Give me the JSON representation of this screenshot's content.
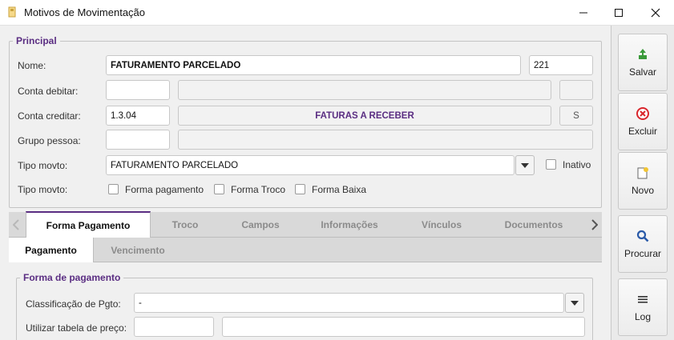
{
  "window": {
    "title": "Motivos de Movimentação",
    "minimize_icon": "minimize-icon",
    "maximize_icon": "maximize-icon",
    "close_icon": "close-icon"
  },
  "principal": {
    "legend": "Principal",
    "nome": {
      "label": "Nome:",
      "value": "FATURAMENTO PARCELADO",
      "code": "221"
    },
    "conta_debitar": {
      "label": "Conta debitar:",
      "code": "",
      "description": "",
      "flag": ""
    },
    "conta_creditar": {
      "label": "Conta creditar:",
      "code": "1.3.04",
      "description": "FATURAS A RECEBER",
      "flag": "S"
    },
    "grupo_pessoa": {
      "label": "Grupo pessoa:",
      "code": "",
      "description": ""
    },
    "tipo_movto": {
      "label": "Tipo movto:",
      "value": "FATURAMENTO PARCELADO",
      "inativo_label": "Inativo",
      "inativo_checked": false
    },
    "tipo_movto2": {
      "label": "Tipo movto:",
      "options": [
        {
          "label": "Forma pagamento",
          "checked": false
        },
        {
          "label": "Forma Troco",
          "checked": false
        },
        {
          "label": "Forma Baixa",
          "checked": false
        }
      ]
    }
  },
  "tabs": [
    "Forma Pagamento",
    "Troco",
    "Campos",
    "Informações",
    "Vínculos",
    "Documentos"
  ],
  "active_tab": "Forma Pagamento",
  "subtabs": [
    "Pagamento",
    "Vencimento"
  ],
  "active_subtab": "Pagamento",
  "forma_pagamento": {
    "legend": "Forma de pagamento",
    "classificacao": {
      "label": "Classificação de Pgto:",
      "value": "-"
    },
    "tabela_preco": {
      "label": "Utilizar tabela de preço:",
      "code": "",
      "description": ""
    }
  },
  "sidebar": {
    "buttons": [
      {
        "label": "Salvar",
        "icon": "save-icon"
      },
      {
        "label": "Excluir",
        "icon": "delete-icon"
      },
      {
        "label": "Novo",
        "icon": "new-icon"
      },
      {
        "label": "Procurar",
        "icon": "search-icon"
      },
      {
        "label": "Log",
        "icon": "log-icon"
      }
    ]
  },
  "colors": {
    "accent": "#5a2d82",
    "delete": "#d9262c",
    "save": "#3a9a3a",
    "search": "#2a5aa8"
  }
}
